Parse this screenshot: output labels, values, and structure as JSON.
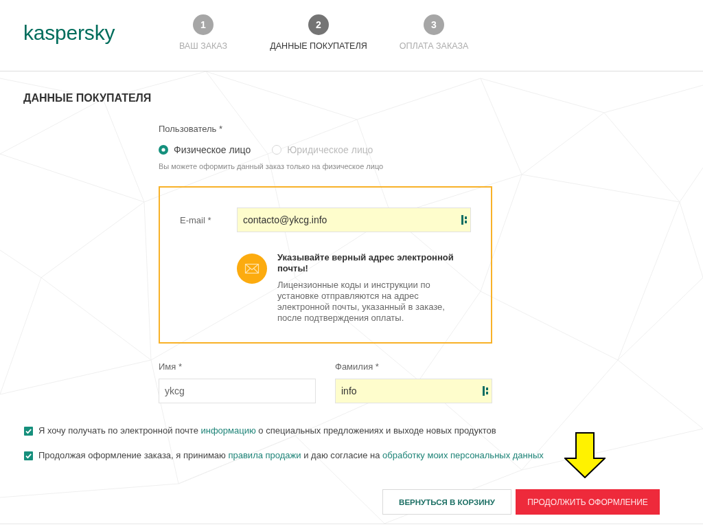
{
  "header": {
    "logo": "kaspersky",
    "steps": [
      {
        "number": "1",
        "label": "ВАШ ЗАКАЗ",
        "selected": false
      },
      {
        "number": "2",
        "label": "ДАННЫЕ ПОКУПАТЕЛЯ",
        "selected": true
      },
      {
        "number": "3",
        "label": "ОПЛАТА ЗАКАЗА",
        "selected": false
      }
    ]
  },
  "section_title": "ДАННЫЕ ПОКУПАТЕЛЯ",
  "user_type": {
    "label": "Пользователь *",
    "options": [
      {
        "label": "Физическое лицо",
        "selected": true,
        "disabled": false
      },
      {
        "label": "Юридическое лицо",
        "selected": false,
        "disabled": true
      }
    ],
    "hint": "Вы можете оформить данный заказ только на физическое лицо"
  },
  "email_panel": {
    "label": "E-mail *",
    "value": "contacto@ykcg.info",
    "autofilled": true,
    "notice_title": "Указывайте верный адрес электронной почты!",
    "notice_text": "Лицензионные коды и инструкции по установке отправляются на адрес электронной почты, указанный в заказе, после подтверждения оплаты."
  },
  "name_fields": [
    {
      "label": "Имя *",
      "value": "ykcg",
      "autofilled": false
    },
    {
      "label": "Фамилия *",
      "value": "info",
      "autofilled": true
    }
  ],
  "consents": [
    {
      "checked": true,
      "parts": [
        {
          "kind": "text",
          "text": "Я хочу получать по электронной почте"
        },
        {
          "kind": "link",
          "text": "информацию"
        },
        {
          "kind": "text",
          "text": "о специальных предложениях и выходе новых продуктов"
        }
      ]
    },
    {
      "checked": true,
      "parts": [
        {
          "kind": "text",
          "text": "Продолжая оформление заказа, я принимаю"
        },
        {
          "kind": "link",
          "text": "правила продажи"
        },
        {
          "kind": "text",
          "text": "и даю согласие на"
        },
        {
          "kind": "link",
          "text": "обработку моих персональных данных"
        }
      ]
    }
  ],
  "buttons": [
    {
      "label": "ВЕРНУТЬСЯ В КОРЗИНУ",
      "kind": "secondary"
    },
    {
      "label": "ПРОДОЛЖИТЬ ОФОРМЛЕНИЕ",
      "kind": "primary"
    }
  ]
}
